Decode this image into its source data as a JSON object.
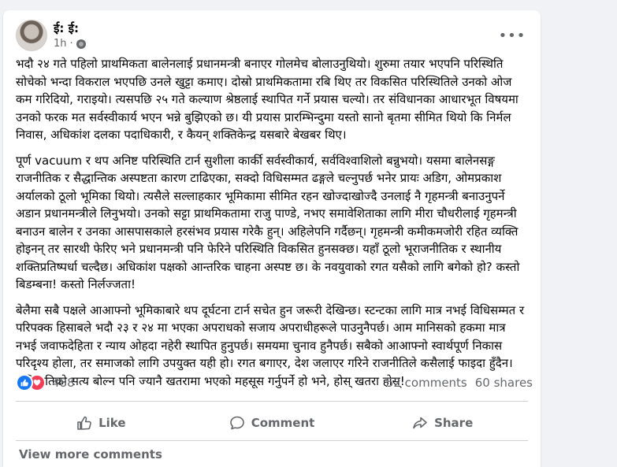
{
  "post": {
    "author": "ई: ई:",
    "time": "1h",
    "more_label": "•••",
    "paragraphs": [
      "भदौ २४ गते पहिलो प्राथमिकता बालेनलाई प्रधानमन्त्री बनाएर गोलमेच बोलाउनुथियो। शुरुमा तयार भएपनि परिस्थिति सोचेको भन्दा विकराल भएपछि उनले खुट्टा कमाए। दोस्रो प्राथमिकतामा रबि थिए तर विकसित परिस्थितिले उनको ओज कम गरिदियो, गराइयो। त्यसपछि २५ गते कल्याण श्रेष्ठलाई स्थापित गर्ने प्रयास चल्यो। तर संविधानका आधारभूत विषयमा उनको फरक मत सर्वस्वीकार्य भएन भन्ने बुझिएको छ। यी प्रयास प्रारम्भिन्दुमा यस्तो सानो बृतमा सीमित थियो कि निर्मल निवास, अधिकांश दलका पदाधिकारी, र कैयन् शक्तिकेन्द्र यसबारे बेखबर थिए।",
      "पूर्ण vacuum र थप अनिष्ट परिस्थिति टार्न सुशीला कार्की सर्वस्वीकार्य, सर्वविश्वाशिलो बन्नुभयो। यसमा बालेनसङ्ग राजनीतिक र सैद्धान्तिक अस्पष्टता कारण टाढिएका, सक्दो विधिसम्मत ढङ्गले चल्नुपर्छ भनेर प्रायः अडिग, ओमप्रकाश अर्यालको ठूलो भूमिका थियो। त्यसैले सल्लाहकार भूमिकामा सीमित रहन खोज्दाखोज्दै उनलाई नै गृहमन्त्री बनाउनुपर्ने अडान प्रधानमन्त्रीले लिनुभयो। उनको सट्टा प्राथमिकतामा राजु पाण्डे, नभए समावेशिताका लागि मीरा चौधरीलाई गृहमन्त्री बनाउन बालेन र उनका आसपासकाले हरसंभव प्रयास गरेकै हुन्। अहिलेपनि गर्दैछन्। गृहमन्त्री कमीकमजोरी रहित व्यक्ति होइनन् तर सारथी फेरिए भने प्रधानमन्त्री पनि फेरिने परिस्थिति विकसित हुनसक्छ। यहाँ ठूलो भूराजनीतिक र स्थानीय शक्तिप्रतिष्पर्धा चल्दैछ। अधिकांश पक्षको आन्तरिक चाहना अस्पष्ट छ। के नवयुवाको रगत यसैको लागि बगेको हो? कस्तो बिडम्बना! कस्तो निर्लज्जता!",
      "बेलैमा सबै पक्षले आआफ्नो भूमिकाबारे थप दूर्घटना टार्न सचेत हुन जरूरी देखिन्छ। स्टन्टका लागि मात्र नभई विधिसम्मत र परिपक्क हिसाबले भदौ २३ र २४ मा भएका अपराधको सजाय अपराधीहरूले पाउनुनैपर्छ। आम मानिसको हकमा मात्र नभई जवाफदेहिता र न्याय ओहदा नहेरी स्थापित हुनुपर्छ। समयमा चुनाव हुनैपर्छ। सबैको आआफ्नो स्वार्थपूर्ण निकास परिदृश्य होला, तर समाजको लागि उपयुक्त यही हो। रगत बगाएर, देश जलाएर गरिने राजनीतिले कसैलाई फाइदा हुँदैन। अनि यतिको सत्य बोल्न पनि ज्यानै खतरामा भएको महसूस गर्नुपर्ने हो भने, होस् खतरा होस्!"
    ]
  },
  "stats": {
    "reactions": "488",
    "comments": "52 comments",
    "shares": "60 shares"
  },
  "actions": {
    "like": "Like",
    "comment": "Comment",
    "share": "Share"
  },
  "comments": {
    "view_more": "View more comments"
  },
  "colors": {
    "page_bg": "#f0f2f5",
    "card_bg": "#ffffff",
    "text": "#050505",
    "secondary": "#65676b",
    "like_blue": "#1877f2",
    "love_red": "#f33e58"
  }
}
